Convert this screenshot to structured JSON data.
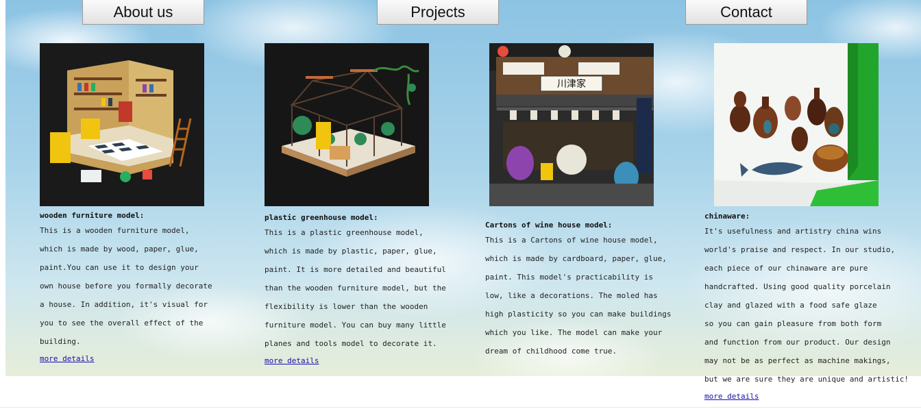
{
  "nav": {
    "about": "About us",
    "projects": "Projects",
    "contact": "Contact"
  },
  "colors": {
    "link": "#1a0dab",
    "sky": "#a9d4ea"
  },
  "cards": [
    {
      "image_icon": "dollhouse-room-photo",
      "caption": "wooden furniture model:",
      "lines": [
        "This is a wooden furniture model,",
        "which is made by wood, paper, glue,",
        "paint.You can use it to design your",
        "own house before you formally decorate",
        "a house. In addition, it's visual for",
        "you to see the overall effect of the",
        "building."
      ],
      "link": "more details"
    },
    {
      "image_icon": "greenhouse-model-photo",
      "caption": "plastic greenhouse model:",
      "lines": [
        "This is a plastic greenhouse model,",
        "which is made by plastic, paper, glue,",
        "paint. It is more detailed and beautiful",
        "than the wooden furniture model, but the",
        "flexibility is lower than the wooden",
        "furniture model. You can buy many little",
        "planes and tools model to decorate it."
      ],
      "link": "more details"
    },
    {
      "image_icon": "wine-house-model-photo",
      "caption": "Cartons of wine house model:",
      "lines": [
        "This is a Cartons of wine house model,",
        "which is made by cardboard, paper, glue,",
        "paint. This model's practicability is",
        "low, like a decorations. The moled has",
        "high plasticity so you can make buildings",
        "which you like. The model can make your",
        "dream of childhood come true."
      ],
      "sign_text": "川津家"
    },
    {
      "image_icon": "chinaware-vases-photo",
      "caption": "chinaware:",
      "lines": [
        "It's usefulness and artistry china wins",
        "world's praise and respect. In our studio,",
        "each piece of our chinaware are pure",
        "handcrafted. Using good quality porcelain",
        "clay and glazed with a food safe glaze",
        "so you can gain pleasure from both form",
        "and function from our product. Our design",
        "may not be as perfect as machine makings,",
        "but we are sure they are unique and artistic!"
      ],
      "link": "more details"
    }
  ]
}
